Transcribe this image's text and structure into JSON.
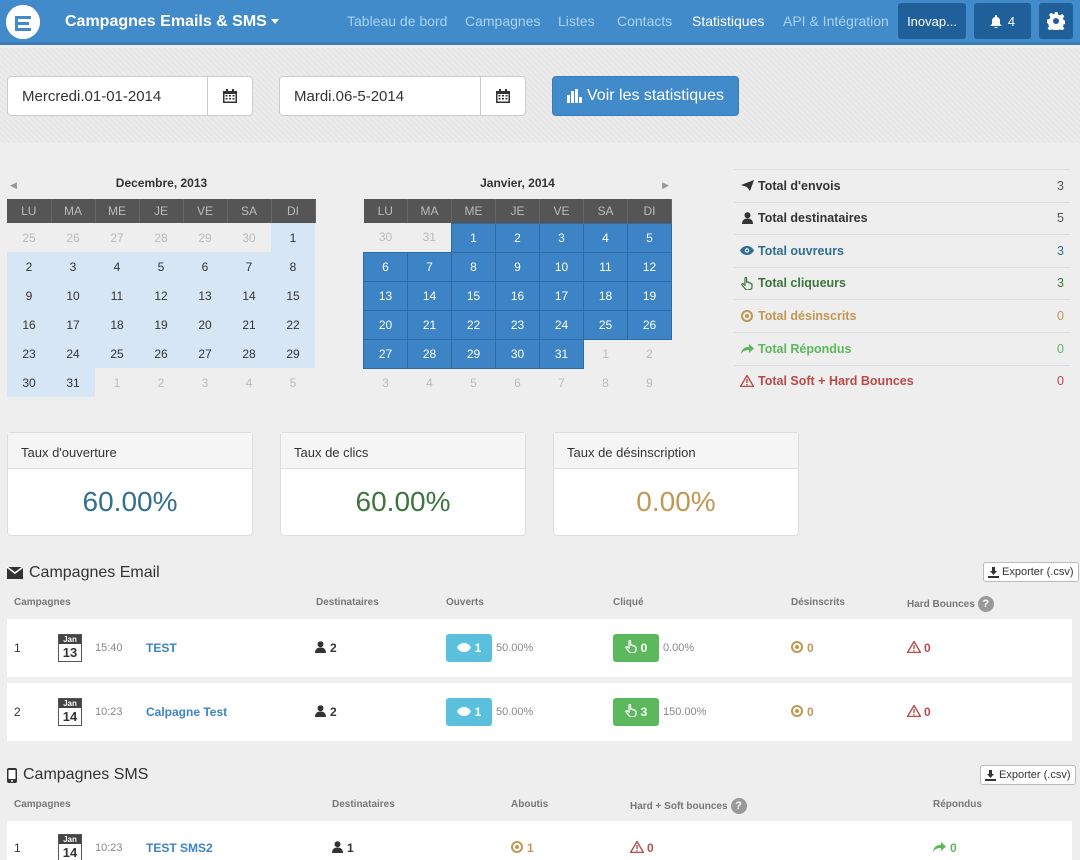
{
  "nav": {
    "app_title": "Campagnes Emails & SMS",
    "links": [
      {
        "label": "Tableau de bord",
        "active": false
      },
      {
        "label": "Campagnes",
        "active": false
      },
      {
        "label": "Listes",
        "active": false
      },
      {
        "label": "Contacts",
        "active": false
      },
      {
        "label": "Statistiques",
        "active": true
      },
      {
        "label": "API & Intégration",
        "active": false
      }
    ],
    "account_label": "Inovap...",
    "notif_count": "4",
    "icons": {
      "logo": "logo-icon",
      "bell": "bell-icon",
      "settings": "gear-icon"
    }
  },
  "filters": {
    "start_date": "Mercredi.01-01-2014",
    "end_date": "Mardi.06-5-2014",
    "submit_label": "Voir les statistiques"
  },
  "calendars": {
    "weekdays": [
      "LU",
      "MA",
      "ME",
      "JE",
      "VE",
      "SA",
      "DI"
    ],
    "left": {
      "title": "Decembre, 2013",
      "weeks": [
        [
          "25",
          "26",
          "27",
          "28",
          "29",
          "30",
          "1"
        ],
        [
          "2",
          "3",
          "4",
          "5",
          "6",
          "7",
          "8"
        ],
        [
          "9",
          "10",
          "11",
          "12",
          "13",
          "14",
          "15"
        ],
        [
          "16",
          "17",
          "18",
          "19",
          "20",
          "21",
          "22"
        ],
        [
          "23",
          "24",
          "25",
          "26",
          "27",
          "28",
          "29"
        ],
        [
          "30",
          "31",
          "1",
          "2",
          "3",
          "4",
          "5"
        ]
      ]
    },
    "right": {
      "title": "Janvier, 2014",
      "weeks": [
        [
          "30",
          "31",
          "1",
          "2",
          "3",
          "4",
          "5"
        ],
        [
          "6",
          "7",
          "8",
          "9",
          "10",
          "11",
          "12"
        ],
        [
          "13",
          "14",
          "15",
          "16",
          "17",
          "18",
          "19"
        ],
        [
          "20",
          "21",
          "22",
          "23",
          "24",
          "25",
          "26"
        ],
        [
          "27",
          "28",
          "29",
          "30",
          "31",
          "1",
          "2"
        ],
        [
          "3",
          "4",
          "5",
          "6",
          "7",
          "8",
          "9"
        ]
      ]
    }
  },
  "totals": [
    {
      "label": "Total d'envois",
      "value": "3",
      "color": "#333333",
      "icon": "send-icon"
    },
    {
      "label": "Total destinataires",
      "value": "5",
      "color": "#333333",
      "icon": "user-icon"
    },
    {
      "label": "Total ouvreurs",
      "value": "3",
      "color": "#31708f",
      "icon": "eye-icon"
    },
    {
      "label": "Total cliqueurs",
      "value": "3",
      "color": "#3c763d",
      "icon": "hand-pointer-icon"
    },
    {
      "label": "Total désinscrits",
      "value": "0",
      "color": "#c09853",
      "icon": "unsubscribe-icon"
    },
    {
      "label": "Total Répondus",
      "value": "0",
      "color": "#5cb85c",
      "icon": "reply-icon"
    },
    {
      "label": "Total Soft + Hard Bounces",
      "value": "0",
      "color": "#b94a48",
      "icon": "warning-icon"
    }
  ],
  "rates": [
    {
      "label": "Taux d'ouverture",
      "value": "60.00%",
      "color": "#31708f"
    },
    {
      "label": "Taux de clics",
      "value": "60.00%",
      "color": "#3c763d"
    },
    {
      "label": "Taux de désinscription",
      "value": "0.00%",
      "color": "#c09853"
    }
  ],
  "email_section": {
    "title": "Campagnes Email",
    "export_label": "Exporter (.csv)",
    "columns": [
      "Campagnes",
      "Destinataires",
      "Ouverts",
      "Cliqué",
      "Désinscrits",
      "Hard Bounces"
    ],
    "rows": [
      {
        "index": "1",
        "month": "Jan",
        "day": "13",
        "time": "15:40",
        "name": "TEST",
        "recipients": "2",
        "opened": "1",
        "opened_pct": "50.00%",
        "clicked": "0",
        "clicked_pct": "0.00%",
        "unsub": "0",
        "bounces": "0"
      },
      {
        "index": "2",
        "month": "Jan",
        "day": "14",
        "time": "10:23",
        "name": "Calpagne Test",
        "recipients": "2",
        "opened": "1",
        "opened_pct": "50.00%",
        "clicked": "3",
        "clicked_pct": "150.00%",
        "unsub": "0",
        "bounces": "0"
      }
    ]
  },
  "sms_section": {
    "title": "Campagnes SMS",
    "export_label": "Exporter (.csv)",
    "columns": [
      "Campagnes",
      "Destinataires",
      "Aboutis",
      "Hard + Soft bounces",
      "Répondus"
    ],
    "rows": [
      {
        "index": "1",
        "month": "Jan",
        "day": "14",
        "time": "10:23",
        "name": "TEST SMS2",
        "recipients": "1",
        "delivered": "1",
        "bounces": "0",
        "replied": "0"
      }
    ]
  },
  "colors": {
    "primary": "#428bca",
    "info": "#5bc0de",
    "success": "#5cb85c",
    "warning": "#c09853",
    "danger": "#b94a48"
  }
}
